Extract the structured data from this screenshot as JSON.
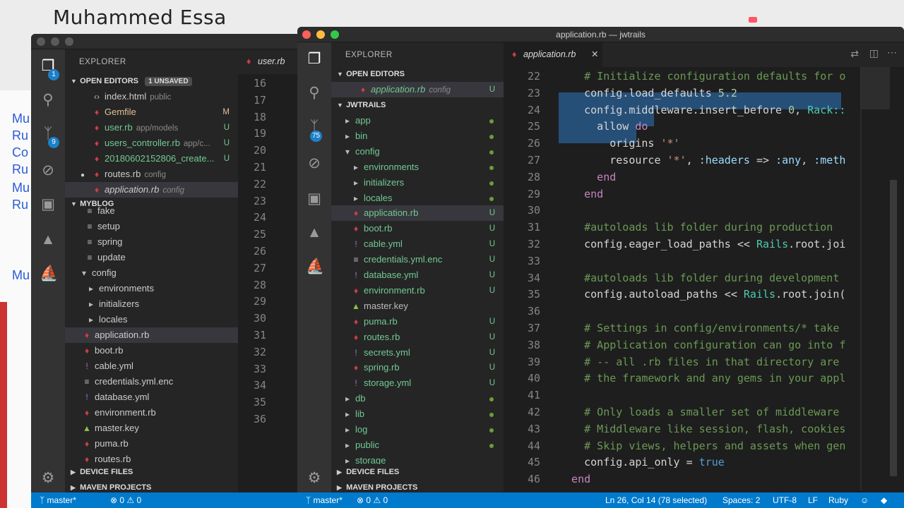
{
  "page_title": "Muhammed Essa",
  "bg_strip_texts": [
    "Mu",
    "Ru",
    "Co",
    "Ru",
    "Mu",
    "Ru",
    "Mu"
  ],
  "back_window": {
    "activity_badges": {
      "explorer": "1",
      "scm": "9"
    },
    "explorer_title": "EXPLORER",
    "open_editors_label": "OPEN EDITORS",
    "unsaved_badge": "1 UNSAVED",
    "open_editors": [
      {
        "name": "index.html",
        "desc": "public",
        "status": "",
        "kind": "html"
      },
      {
        "name": "Gemfile",
        "desc": "",
        "status": "M",
        "kind": "ruby"
      },
      {
        "name": "user.rb",
        "desc": "app/models",
        "status": "U",
        "kind": "ruby"
      },
      {
        "name": "users_controller.rb",
        "desc": "app/c...",
        "status": "U",
        "kind": "ruby"
      },
      {
        "name": "20180602152806_create...",
        "desc": "",
        "status": "U",
        "kind": "ruby"
      },
      {
        "name": "routes.rb",
        "desc": "config",
        "status": "",
        "kind": "ruby"
      },
      {
        "name": "application.rb",
        "desc": "config",
        "status": "",
        "kind": "ruby"
      }
    ],
    "project_label": "MYBLOG",
    "tree": [
      {
        "name": "fake",
        "kind": "plain"
      },
      {
        "name": "setup",
        "kind": "plain"
      },
      {
        "name": "spring",
        "kind": "plain"
      },
      {
        "name": "update",
        "kind": "plain"
      },
      {
        "name": "config",
        "kind": "folder-open"
      },
      {
        "name": "environments",
        "kind": "folder"
      },
      {
        "name": "initializers",
        "kind": "folder"
      },
      {
        "name": "locales",
        "kind": "folder"
      },
      {
        "name": "application.rb",
        "kind": "ruby"
      },
      {
        "name": "boot.rb",
        "kind": "ruby"
      },
      {
        "name": "cable.yml",
        "kind": "yml"
      },
      {
        "name": "credentials.yml.enc",
        "kind": "plain"
      },
      {
        "name": "database.yml",
        "kind": "yml"
      },
      {
        "name": "environment.rb",
        "kind": "ruby"
      },
      {
        "name": "master.key",
        "kind": "key"
      },
      {
        "name": "puma.rb",
        "kind": "ruby"
      },
      {
        "name": "routes.rb",
        "kind": "ruby"
      }
    ],
    "device_files": "DEVICE FILES",
    "maven_projects": "MAVEN PROJECTS",
    "tab_label": "user.rb",
    "line_numbers": [
      "16",
      "17",
      "18",
      "19",
      "20",
      "21",
      "22",
      "23",
      "24",
      "25",
      "26",
      "27",
      "28",
      "29",
      "30",
      "31",
      "32",
      "33",
      "34",
      "35",
      "36"
    ],
    "status_branch": "master*",
    "status_problems": "0",
    "status_warnings": "0"
  },
  "front_window": {
    "title": "application.rb — jwtrails",
    "activity_badges": {
      "scm": "75"
    },
    "explorer_title": "EXPLORER",
    "open_editors_label": "OPEN EDITORS",
    "open_editors": [
      {
        "name": "application.rb",
        "desc": "config",
        "status": "U"
      }
    ],
    "project_label": "JWTRAILS",
    "tree": [
      {
        "name": "app",
        "kind": "folder",
        "depth": 0,
        "dot": true
      },
      {
        "name": "bin",
        "kind": "folder",
        "depth": 0,
        "dot": true
      },
      {
        "name": "config",
        "kind": "folder-open",
        "depth": 0,
        "dot": true
      },
      {
        "name": "environments",
        "kind": "folder",
        "depth": 1,
        "dot": true
      },
      {
        "name": "initializers",
        "kind": "folder",
        "depth": 1,
        "dot": true
      },
      {
        "name": "locales",
        "kind": "folder",
        "depth": 1,
        "dot": true
      },
      {
        "name": "application.rb",
        "kind": "ruby",
        "depth": 1,
        "status": "U",
        "selected": true
      },
      {
        "name": "boot.rb",
        "kind": "ruby",
        "depth": 1,
        "status": "U"
      },
      {
        "name": "cable.yml",
        "kind": "yml",
        "depth": 1,
        "status": "U"
      },
      {
        "name": "credentials.yml.enc",
        "kind": "plain",
        "depth": 1,
        "status": "U"
      },
      {
        "name": "database.yml",
        "kind": "yml",
        "depth": 1,
        "status": "U"
      },
      {
        "name": "environment.rb",
        "kind": "ruby",
        "depth": 1,
        "status": "U"
      },
      {
        "name": "master.key",
        "kind": "key",
        "depth": 1,
        "status": ""
      },
      {
        "name": "puma.rb",
        "kind": "ruby",
        "depth": 1,
        "status": "U"
      },
      {
        "name": "routes.rb",
        "kind": "ruby",
        "depth": 1,
        "status": "U"
      },
      {
        "name": "secrets.yml",
        "kind": "yml",
        "depth": 1,
        "status": "U"
      },
      {
        "name": "spring.rb",
        "kind": "ruby",
        "depth": 1,
        "status": "U"
      },
      {
        "name": "storage.yml",
        "kind": "yml",
        "depth": 1,
        "status": "U"
      },
      {
        "name": "db",
        "kind": "folder",
        "depth": 0,
        "dot": true
      },
      {
        "name": "lib",
        "kind": "folder",
        "depth": 0,
        "dot": true
      },
      {
        "name": "log",
        "kind": "folder",
        "depth": 0,
        "dot": true
      },
      {
        "name": "public",
        "kind": "folder",
        "depth": 0,
        "dot": true
      },
      {
        "name": "storage",
        "kind": "folder",
        "depth": 0,
        "dot": false
      }
    ],
    "device_files": "DEVICE FILES",
    "maven_projects": "MAVEN PROJECTS",
    "tab_label": "application.rb",
    "code_lines": [
      {
        "n": "22",
        "tokens": [
          [
            "cmt",
            "    # Initialize configuration defaults for o"
          ]
        ]
      },
      {
        "n": "23",
        "tokens": [
          [
            "",
            "    config.load_defaults "
          ],
          [
            "num",
            "5.2"
          ]
        ]
      },
      {
        "n": "24",
        "tokens": [
          [
            "",
            "    config.middleware.insert_before "
          ],
          [
            "num",
            "0"
          ],
          [
            "",
            ", "
          ],
          [
            "cls",
            "Rack::"
          ]
        ]
      },
      {
        "n": "25",
        "tokens": [
          [
            "",
            "      allow "
          ],
          [
            "kw",
            "do"
          ]
        ]
      },
      {
        "n": "26",
        "tokens": [
          [
            "",
            "        origins "
          ],
          [
            "str",
            "'*'"
          ]
        ]
      },
      {
        "n": "27",
        "tokens": [
          [
            "",
            "        resource "
          ],
          [
            "str",
            "'*'"
          ],
          [
            "",
            ", "
          ],
          [
            "sym",
            ":headers"
          ],
          [
            "",
            " => "
          ],
          [
            "sym",
            ":any"
          ],
          [
            "",
            ", "
          ],
          [
            "sym",
            ":meth"
          ]
        ]
      },
      {
        "n": "28",
        "tokens": [
          [
            "kw",
            "      end"
          ]
        ]
      },
      {
        "n": "29",
        "tokens": [
          [
            "kw",
            "    end"
          ]
        ]
      },
      {
        "n": "30",
        "tokens": [
          [
            "",
            ""
          ]
        ]
      },
      {
        "n": "31",
        "tokens": [
          [
            "cmt",
            "    #autoloads lib folder during production"
          ]
        ]
      },
      {
        "n": "32",
        "tokens": [
          [
            "",
            "    config.eager_load_paths << "
          ],
          [
            "cls",
            "Rails"
          ],
          [
            "",
            ".root.joi"
          ]
        ]
      },
      {
        "n": "33",
        "tokens": [
          [
            "",
            ""
          ]
        ]
      },
      {
        "n": "34",
        "tokens": [
          [
            "cmt",
            "    #autoloads lib folder during development"
          ]
        ]
      },
      {
        "n": "35",
        "tokens": [
          [
            "",
            "    config.autoload_paths << "
          ],
          [
            "cls",
            "Rails"
          ],
          [
            "",
            ".root.join("
          ]
        ]
      },
      {
        "n": "36",
        "tokens": [
          [
            "",
            ""
          ]
        ]
      },
      {
        "n": "37",
        "tokens": [
          [
            "cmt",
            "    # Settings in config/environments/* take"
          ]
        ]
      },
      {
        "n": "38",
        "tokens": [
          [
            "cmt",
            "    # Application configuration can go into f"
          ]
        ]
      },
      {
        "n": "39",
        "tokens": [
          [
            "cmt",
            "    # -- all .rb files in that directory are"
          ]
        ]
      },
      {
        "n": "40",
        "tokens": [
          [
            "cmt",
            "    # the framework and any gems in your appl"
          ]
        ]
      },
      {
        "n": "41",
        "tokens": [
          [
            "",
            ""
          ]
        ]
      },
      {
        "n": "42",
        "tokens": [
          [
            "cmt",
            "    # Only loads a smaller set of middleware"
          ]
        ]
      },
      {
        "n": "43",
        "tokens": [
          [
            "cmt",
            "    # Middleware like session, flash, cookies"
          ]
        ]
      },
      {
        "n": "44",
        "tokens": [
          [
            "cmt",
            "    # Skip views, helpers and assets when gen"
          ]
        ]
      },
      {
        "n": "45",
        "tokens": [
          [
            "",
            "    config.api_only = "
          ],
          [
            "bool",
            "true"
          ]
        ]
      },
      {
        "n": "46",
        "tokens": [
          [
            "kw",
            "  end"
          ]
        ]
      }
    ],
    "status_branch": "master*",
    "status_problems": "0",
    "status_warnings": "0",
    "status_cursor": "Ln 26, Col 14 (78 selected)",
    "status_spaces": "Spaces: 2",
    "status_encoding": "UTF-8",
    "status_eol": "LF",
    "status_language": "Ruby"
  }
}
